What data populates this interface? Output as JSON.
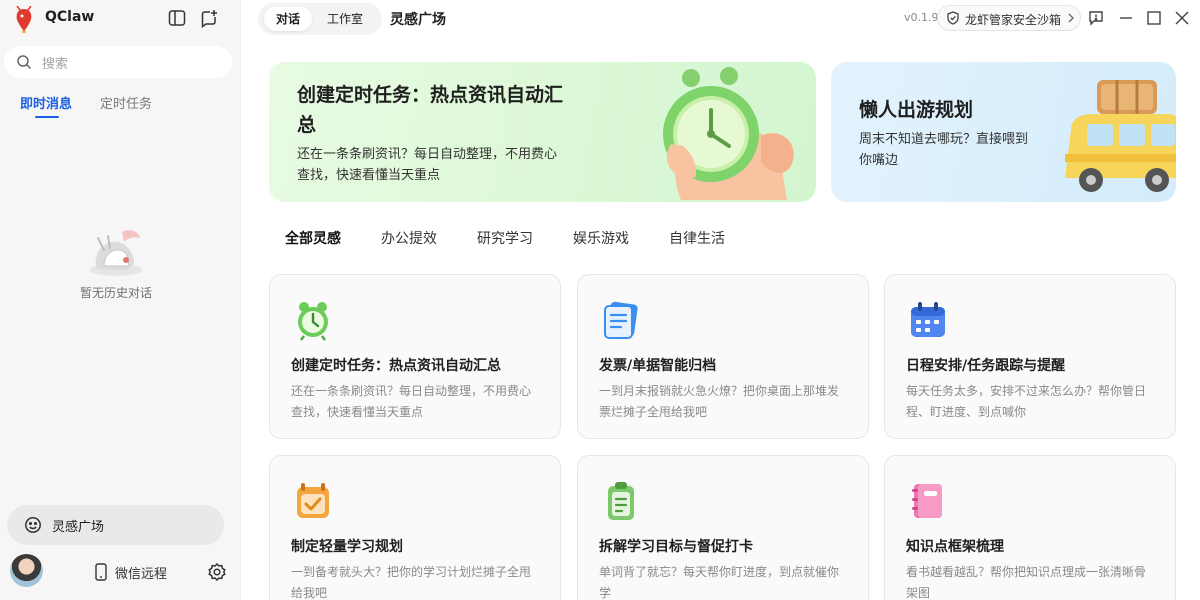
{
  "app": {
    "name": "QClaw"
  },
  "sidebar": {
    "search_placeholder": "搜索",
    "tabs": [
      {
        "label": "即时消息",
        "active": true
      },
      {
        "label": "定时任务",
        "active": false
      }
    ],
    "empty_text": "暂无历史对话",
    "inspiration_button": "灵感广场",
    "wechat_label": "微信远程"
  },
  "topbar": {
    "tabs": [
      {
        "label": "对话",
        "active": true
      },
      {
        "label": "工作室",
        "active": false
      }
    ],
    "title": "灵感广场",
    "version": "v0.1.9",
    "sandbox_label": "龙虾管家安全沙箱"
  },
  "banners": [
    {
      "title": "创建定时任务：热点资讯自动汇总",
      "desc": "还在一条条刷资讯？每日自动整理，不用费心查找，快速看懂当天重点"
    },
    {
      "title": "懒人出游规划",
      "desc": "周末不知道去哪玩？直接喂到你嘴边"
    }
  ],
  "categories": [
    "全部灵感",
    "办公提效",
    "研究学习",
    "娱乐游戏",
    "自律生活"
  ],
  "cards": [
    {
      "title": "创建定时任务：热点资讯自动汇总",
      "desc": "还在一条条刷资讯？每日自动整理，不用费心查找，快速看懂当天重点",
      "icon": "alarm-clock-icon"
    },
    {
      "title": "发票/单据智能归档",
      "desc": "一到月末报销就火急火燎？把你桌面上那堆发票烂摊子全甩给我吧",
      "icon": "invoice-icon"
    },
    {
      "title": "日程安排/任务跟踪与提醒",
      "desc": "每天任务太多，安排不过来怎么办？帮你管日程、盯进度、到点喊你",
      "icon": "calendar-icon"
    },
    {
      "title": "制定轻量学习规划",
      "desc": "一到备考就头大？把你的学习计划烂摊子全甩给我吧",
      "icon": "study-plan-icon"
    },
    {
      "title": "拆解学习目标与督促打卡",
      "desc": "单词背了就忘？每天帮你盯进度，到点就催你学",
      "icon": "checkin-icon"
    },
    {
      "title": "知识点框架梳理",
      "desc": "看书越看越乱？帮你把知识点理成一张清晰骨架图",
      "icon": "notebook-icon"
    }
  ],
  "colors": {
    "accent": "#1a5fe3",
    "banner_green": "#dcf8d6",
    "banner_blue": "#d4ecfb"
  }
}
